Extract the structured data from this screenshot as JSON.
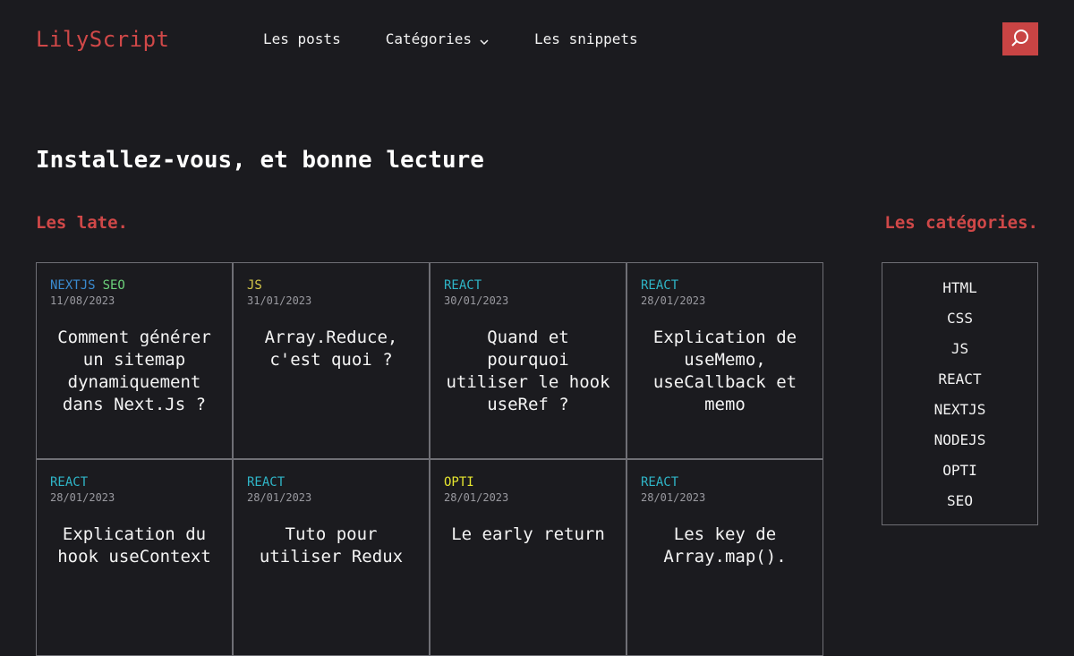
{
  "header": {
    "logo": "LilyScript",
    "nav": [
      {
        "label": "Les posts"
      },
      {
        "label": "Catégories"
      },
      {
        "label": "Les snippets"
      }
    ]
  },
  "page_title": "Installez-vous, et bonne lecture",
  "latest": {
    "title": "Les late.",
    "posts": [
      {
        "tags": [
          "NEXTJS",
          "SEO"
        ],
        "date": "11/08/2023",
        "title": "Comment générer un sitemap dynamiquement dans Next.Js ?"
      },
      {
        "tags": [
          "JS"
        ],
        "date": "31/01/2023",
        "title": "Array.Reduce, c'est quoi ?"
      },
      {
        "tags": [
          "REACT"
        ],
        "date": "30/01/2023",
        "title": "Quand et pourquoi utiliser le hook useRef ?"
      },
      {
        "tags": [
          "REACT"
        ],
        "date": "28/01/2023",
        "title": "Explication de useMemo, useCallback et memo"
      },
      {
        "tags": [
          "REACT"
        ],
        "date": "28/01/2023",
        "title": "Explication du hook useContext"
      },
      {
        "tags": [
          "REACT"
        ],
        "date": "28/01/2023",
        "title": "Tuto pour utiliser Redux"
      },
      {
        "tags": [
          "OPTI"
        ],
        "date": "28/01/2023",
        "title": "Le early return"
      },
      {
        "tags": [
          "REACT"
        ],
        "date": "28/01/2023",
        "title": "Les key de Array.map()."
      }
    ]
  },
  "categories": {
    "title": "Les catégories.",
    "items": [
      "HTML",
      "CSS",
      "JS",
      "REACT",
      "NEXTJS",
      "NODEJS",
      "OPTI",
      "SEO"
    ]
  },
  "colors": {
    "accent": "#d04848",
    "background": "#1b1b1f",
    "tag_nextjs": "#3a8bd0",
    "tag_seo": "#6cd07a",
    "tag_js": "#d6c94a",
    "tag_react": "#2fb5c7",
    "tag_opti": "#e6e62f"
  },
  "icons": {
    "search": "search-icon",
    "dropdown": "chevron-down-icon"
  }
}
